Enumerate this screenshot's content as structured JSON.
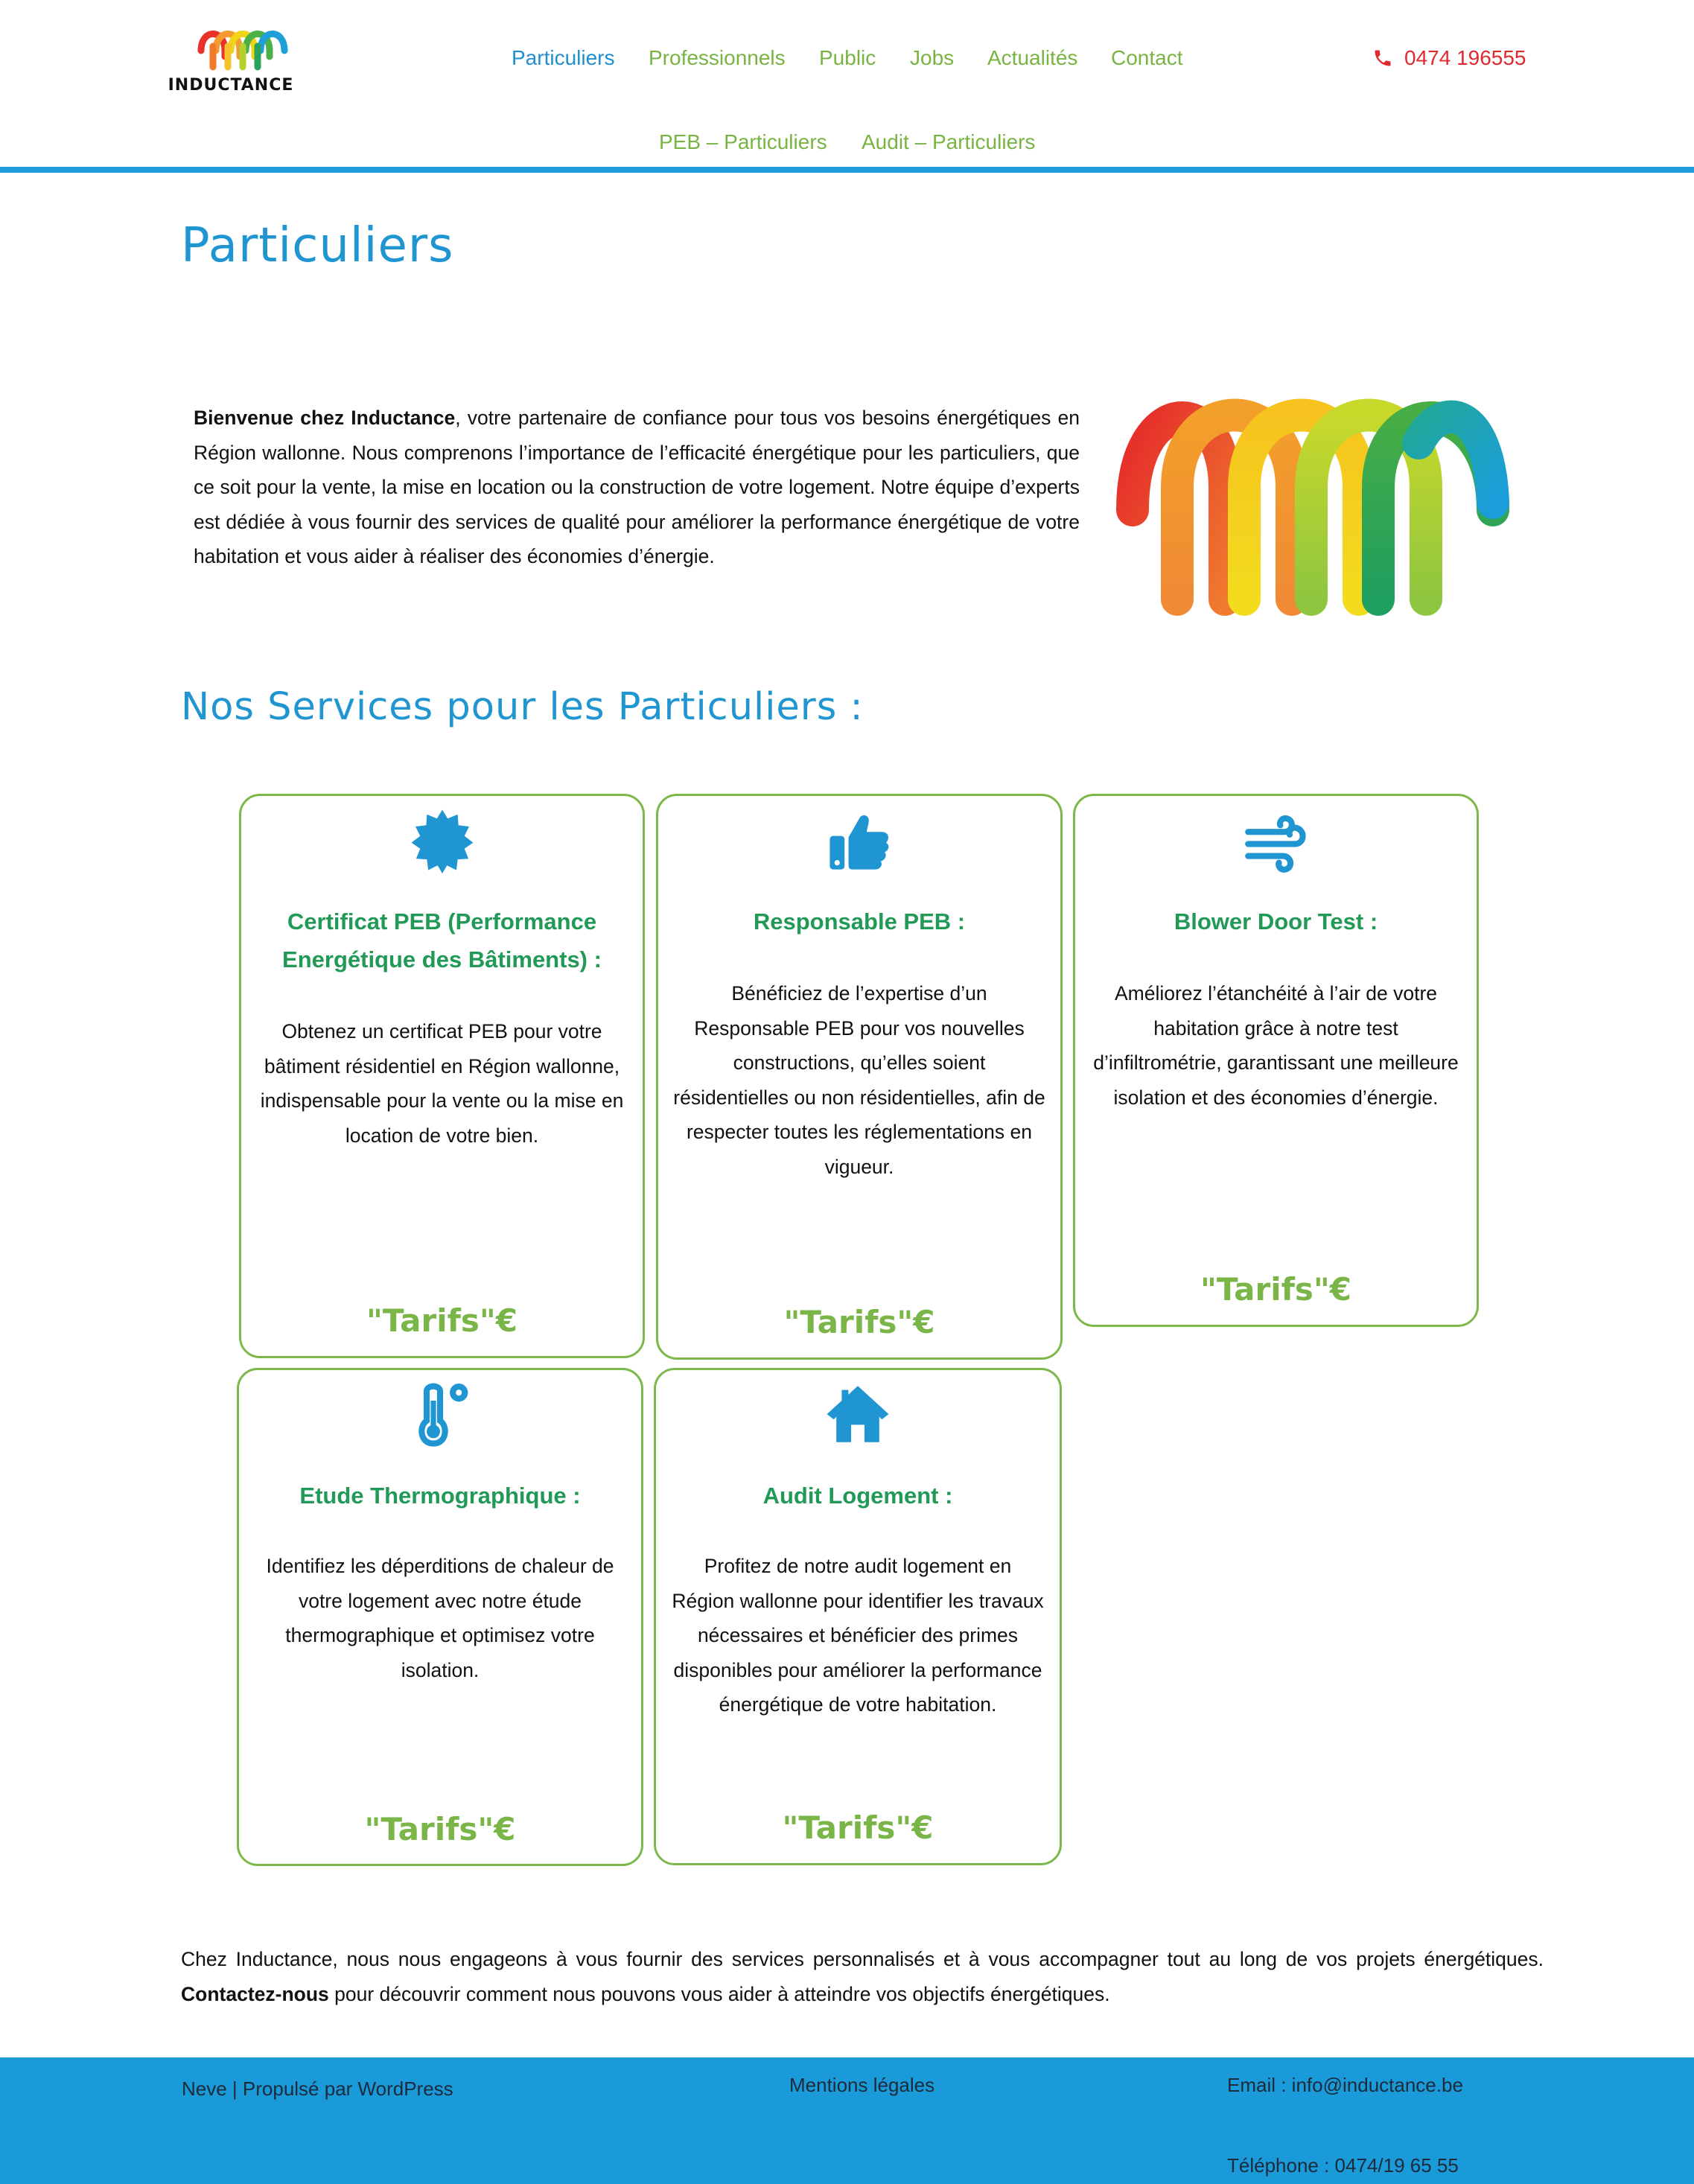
{
  "brand": {
    "name": "INDUCTANCE",
    "colors": {
      "primary_blue": "#1f95d2",
      "green": "#7ab547",
      "dark_green": "#219957",
      "red": "#e0282f",
      "footer_bg": "#1a9ad9"
    }
  },
  "nav": {
    "items": [
      {
        "label": "Particuliers",
        "active": true
      },
      {
        "label": "Professionnels",
        "active": false
      },
      {
        "label": "Public",
        "active": false
      },
      {
        "label": "Jobs",
        "active": false
      },
      {
        "label": "Actualités",
        "active": false
      },
      {
        "label": "Contact",
        "active": false
      }
    ],
    "subitems": [
      {
        "label": "PEB – Particuliers"
      },
      {
        "label": "Audit – Particuliers"
      }
    ],
    "phone": {
      "icon": "phone-icon",
      "number": "0474 196555"
    }
  },
  "page": {
    "title": "Particuliers",
    "intro_bold": "Bienvenue chez Inductance",
    "intro_rest": ", votre partenaire de confiance pour tous vos besoins énergétiques en Région wallonne. Nous comprenons l’importance de l’efficacité énergétique pour les particuliers, que ce soit pour la vente, la mise en location ou la construction de votre logement. Notre équipe d’experts est dédiée à vous fournir des services de qualité pour améliorer la performance énergétique de votre habitation et vous aider à réaliser des économies d’énergie.",
    "services_title": "Nos Services pour les Particuliers :"
  },
  "services": [
    {
      "icon": "badge-icon",
      "title": "Certificat PEB (Performance Energétique des Bâtiments) :",
      "description": "Obtenez un certificat PEB pour votre bâtiment résidentiel en Région wallonne, indispensable pour la vente ou la mise en location de votre bien.",
      "price": "\"Tarifs\"€"
    },
    {
      "icon": "thumbs-up-icon",
      "title": "Responsable PEB :",
      "description": "Bénéficiez de l’expertise d’un Responsable PEB pour vos nouvelles constructions, qu’elles soient résidentielles ou non résidentielles, afin de respecter toutes les réglementations en vigueur.",
      "price": "\"Tarifs\"€"
    },
    {
      "icon": "wind-icon",
      "title": "Blower Door Test :",
      "description": "Améliorez l’étanchéité à l’air de votre habitation grâce à notre test d’infiltrométrie, garantissant une meilleure isolation et des économies d’énergie.",
      "price": "\"Tarifs\"€"
    },
    {
      "icon": "thermometer-icon",
      "title": "Etude Thermographique :",
      "description": "Identifiez les déperditions de chaleur de votre logement avec notre étude thermographique et optimisez votre isolation.",
      "price": "\"Tarifs\"€"
    },
    {
      "icon": "house-icon",
      "title": "Audit Logement :",
      "description": "Profitez de notre audit logement en Région wallonne pour identifier les travaux nécessaires et bénéficier des primes disponibles pour améliorer la performance énergétique de votre habitation.",
      "price": "\"Tarifs\"€"
    }
  ],
  "closing": {
    "text1": "Chez Inductance, nous nous engageons à vous fournir des services personnalisés et à vous accompagner tout au long de vos projets énergétiques.",
    "link": "Contactez-nous",
    "text2": " pour découvrir comment nous pouvons vous aider à atteindre vos objectifs énergétiques."
  },
  "footer": {
    "credit": "Neve | Propulsé par WordPress",
    "legal": "Mentions légales",
    "email": "Email : info@inductance.be",
    "phone": "Téléphone : 0474/19 65 55"
  }
}
